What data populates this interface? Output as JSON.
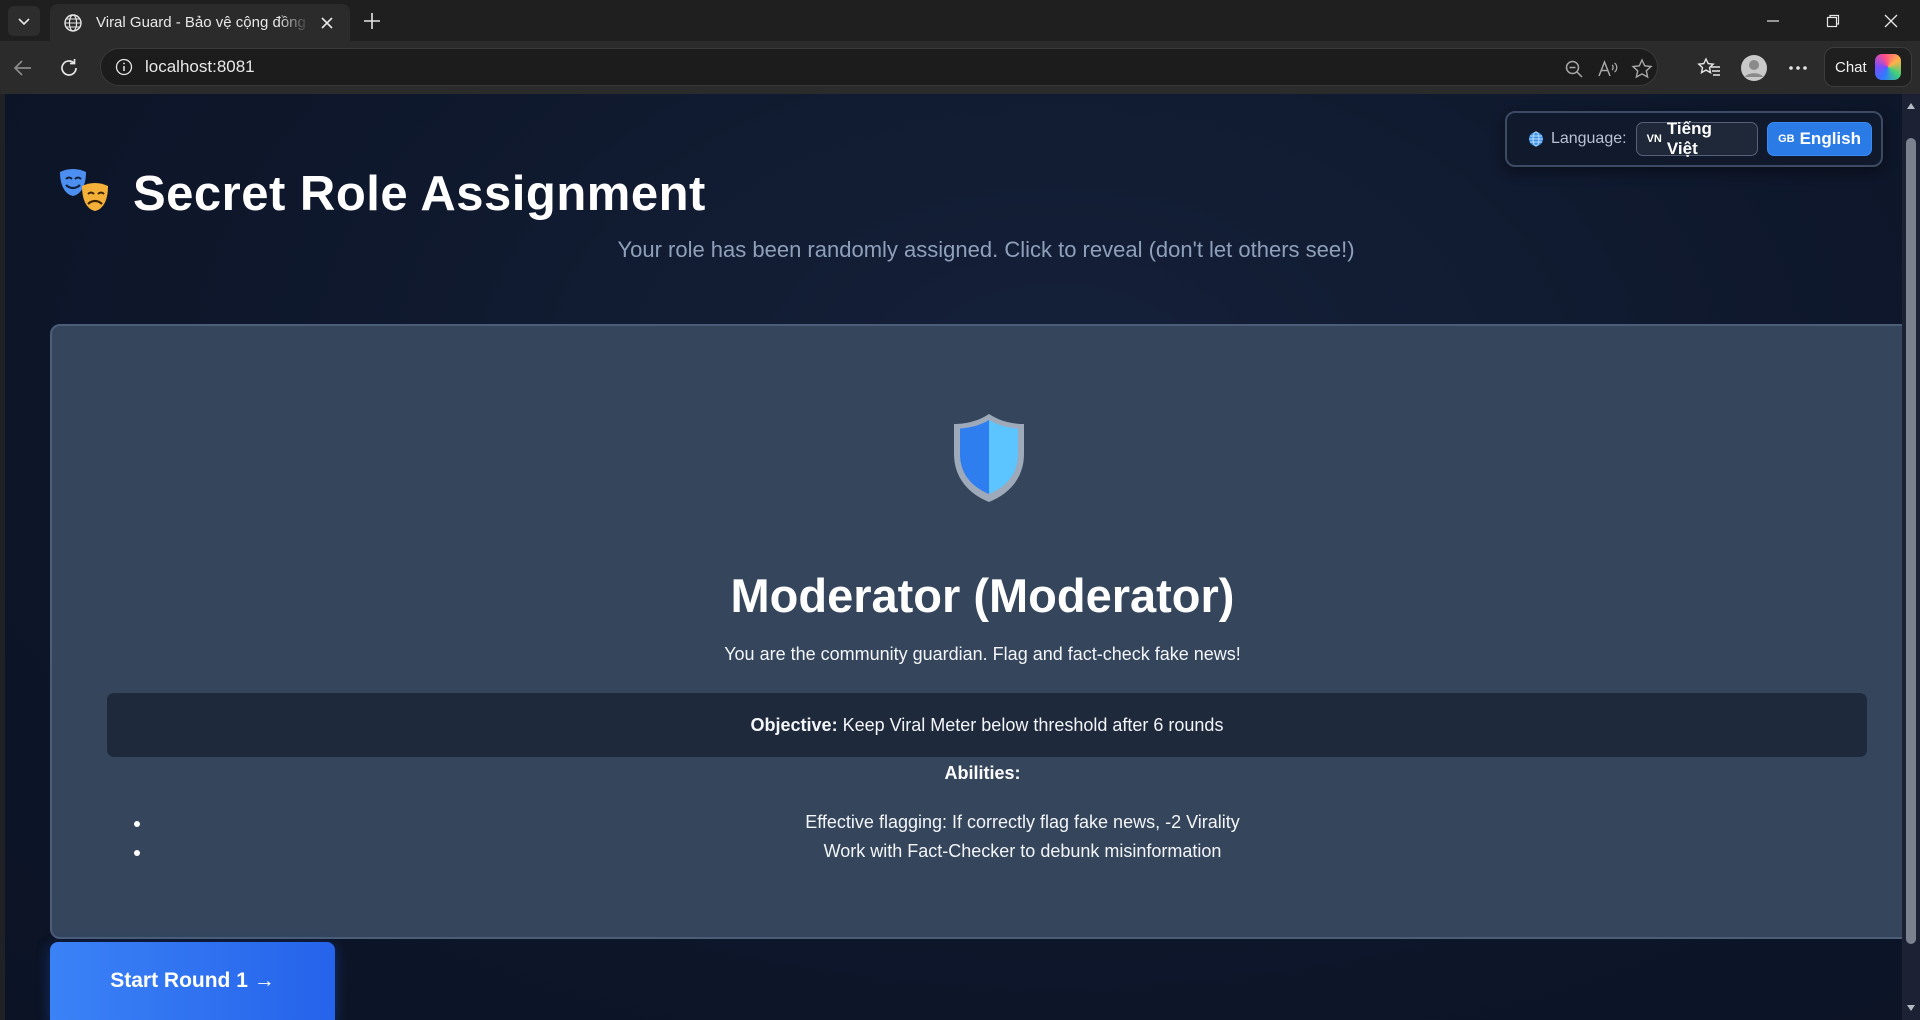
{
  "browser": {
    "tab_title": "Viral Guard - Bảo vệ cộng đồng khỏi tin giả",
    "url": "localhost:8081",
    "chat_label": "Chat"
  },
  "language": {
    "label": "Language:",
    "options": [
      {
        "flag": "VN",
        "name": "Tiếng Việt",
        "active": false
      },
      {
        "flag": "GB",
        "name": "English",
        "active": true
      }
    ]
  },
  "header": {
    "title": "Secret Role Assignment",
    "subtitle": "Your role has been randomly assigned. Click to reveal (don't let others see!)"
  },
  "role": {
    "icon": "shield-icon",
    "title": "Moderator (Moderator)",
    "description": "You are the community guardian. Flag and fact-check fake news!",
    "objective_label": "Objective:",
    "objective": "Keep Viral Meter below threshold after 6 rounds",
    "abilities_label": "Abilities:",
    "abilities": [
      "Effective flagging: If correctly flag fake news, -2 Virality",
      "Work with Fact-Checker to debunk misinformation"
    ]
  },
  "actions": {
    "start_label": "Start Round 1 →"
  },
  "colors": {
    "background": "#0e172b",
    "card": "#34455c",
    "accent": "#2b7be6"
  }
}
